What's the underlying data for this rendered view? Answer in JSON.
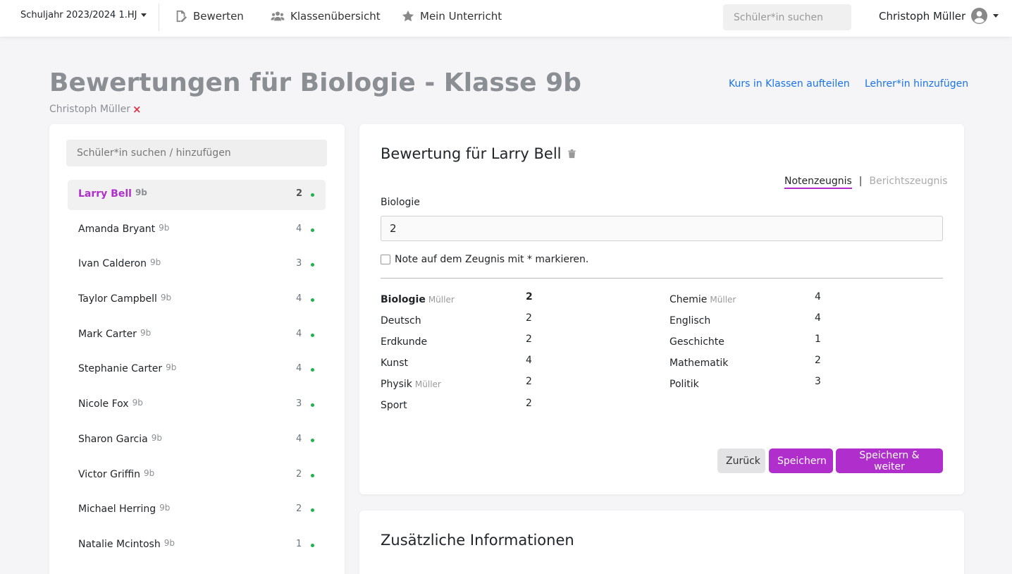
{
  "navbar": {
    "school_year": "Schuljahr 2023/2024 1.HJ",
    "links": {
      "grade": "Bewerten",
      "class_overview": "Klassenübersicht",
      "my_lessons": "Mein Unterricht"
    },
    "search_placeholder": "Schüler*in suchen",
    "user_name": "Christoph Müller"
  },
  "header": {
    "title": "Bewertungen für Biologie - Klasse 9b",
    "teacher": "Christoph Müller",
    "remove_symbol": "×",
    "split_course_link": "Kurs in Klassen aufteilen",
    "add_teacher_link": "Lehrer*in hinzufügen"
  },
  "students": {
    "search_placeholder": "Schüler*in suchen / hinzufügen",
    "items": [
      {
        "name": "Larry Bell",
        "class": "9b",
        "grade": "2"
      },
      {
        "name": "Amanda Bryant",
        "class": "9b",
        "grade": "4"
      },
      {
        "name": "Ivan Calderon",
        "class": "9b",
        "grade": "3"
      },
      {
        "name": "Taylor Campbell",
        "class": "9b",
        "grade": "4"
      },
      {
        "name": "Mark Carter",
        "class": "9b",
        "grade": "4"
      },
      {
        "name": "Stephanie Carter",
        "class": "9b",
        "grade": "4"
      },
      {
        "name": "Nicole Fox",
        "class": "9b",
        "grade": "3"
      },
      {
        "name": "Sharon Garcia",
        "class": "9b",
        "grade": "4"
      },
      {
        "name": "Victor Griffin",
        "class": "9b",
        "grade": "2"
      },
      {
        "name": "Michael Herring",
        "class": "9b",
        "grade": "2"
      },
      {
        "name": "Natalie Mcintosh",
        "class": "9b",
        "grade": "1"
      }
    ]
  },
  "assessment": {
    "title": "Bewertung für Larry Bell",
    "tab_active": "Notenzeugnis",
    "tab_separator": "|",
    "tab_inactive": "Berichtszeugnis",
    "subject_label": "Biologie",
    "grade_value": "2",
    "star_checkbox_label": "Note auf dem Zeugnis mit * markieren.",
    "grades": {
      "biologie": {
        "subject": "Biologie",
        "teacher": "Müller",
        "value": "2"
      },
      "deutsch": {
        "subject": "Deutsch",
        "value": "2"
      },
      "erdkunde": {
        "subject": "Erdkunde",
        "value": "2"
      },
      "kunst": {
        "subject": "Kunst",
        "value": "4"
      },
      "physik": {
        "subject": "Physik",
        "teacher": "Müller",
        "value": "2"
      },
      "sport": {
        "subject": "Sport",
        "value": "2"
      },
      "chemie": {
        "subject": "Chemie",
        "teacher": "Müller",
        "value": "4"
      },
      "englisch": {
        "subject": "Englisch",
        "value": "4"
      },
      "geschichte": {
        "subject": "Geschichte",
        "value": "1"
      },
      "mathematik": {
        "subject": "Mathematik",
        "value": "2"
      },
      "politik": {
        "subject": "Politik",
        "value": "3"
      }
    },
    "buttons": {
      "back": "Zurück",
      "save": "Speichern",
      "save_next": "Speichern & weiter"
    }
  },
  "additional_info": {
    "title": "Zusätzliche Informationen"
  }
}
